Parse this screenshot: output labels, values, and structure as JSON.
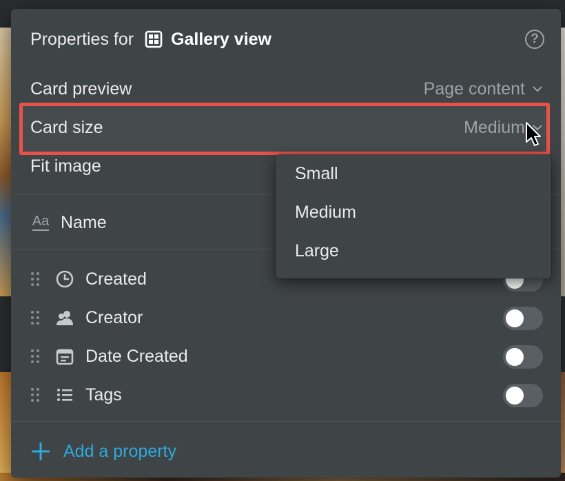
{
  "header": {
    "prefix": "Properties for",
    "view_icon": "gallery-grid-icon",
    "view_name": "Gallery view",
    "help_icon": "help-icon",
    "help_glyph": "?"
  },
  "settings": {
    "card_preview": {
      "label": "Card preview",
      "value": "Page content"
    },
    "card_size": {
      "label": "Card size",
      "value": "Medium",
      "highlight_color": "#e8524a"
    },
    "fit_image": {
      "label": "Fit image"
    }
  },
  "title_property": {
    "icon": "text-aa-icon",
    "icon_text": "Aa",
    "label": "Name"
  },
  "properties": [
    {
      "label": "Created",
      "icon": "clock-icon",
      "toggled": false
    },
    {
      "label": "Creator",
      "icon": "person-icon",
      "toggled": false
    },
    {
      "label": "Date Created",
      "icon": "calendar-icon",
      "toggled": false
    },
    {
      "label": "Tags",
      "icon": "list-icon",
      "toggled": false
    }
  ],
  "add_property": {
    "label": "Add a property",
    "color": "#2eaadc"
  },
  "dropdown": {
    "options": [
      "Small",
      "Medium",
      "Large"
    ]
  },
  "colors": {
    "panel_bg": "#3f4447",
    "text": "#ebebeb",
    "muted": "#9da2a6",
    "accent": "#2eaadc"
  }
}
